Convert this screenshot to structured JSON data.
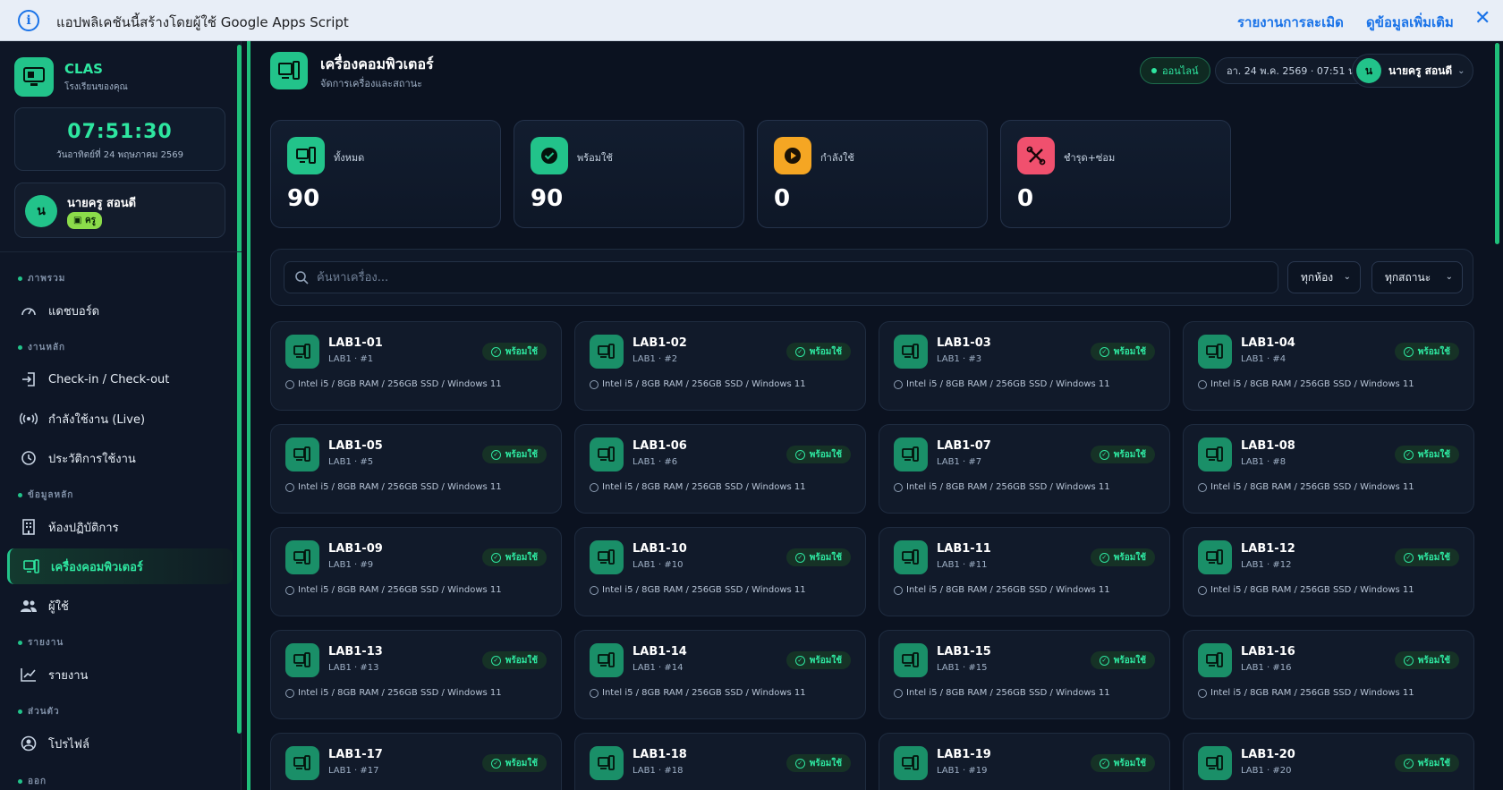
{
  "banner": {
    "text": "แอปพลิเคชันนี้สร้างโดยผู้ใช้ Google Apps Script",
    "report_link": "รายงานการละเมิด",
    "more_link": "ดูข้อมูลเพิ่มเติม",
    "close_icon": "close-icon"
  },
  "sidebar": {
    "brand_title": "CLAS",
    "brand_sub": "โรงเรียนของคุณ",
    "clock_time": "07:51:30",
    "clock_date": "วันอาทิตย์ที่ 24 พฤษภาคม 2569",
    "user_initial": "น",
    "user_name": "นายครู สอนดี",
    "user_role": "ครู",
    "sections": {
      "overview": "ภาพรวม",
      "main": "งานหลัก",
      "master": "ข้อมูลหลัก",
      "report": "รายงาน",
      "personal": "ส่วนตัว",
      "logout": "ออก"
    },
    "items": {
      "dashboard": "แดชบอร์ด",
      "checkin": "Check-in / Check-out",
      "live": "กำลังใช้งาน (Live)",
      "history": "ประวัติการใช้งาน",
      "labs": "ห้องปฏิบัติการ",
      "computers": "เครื่องคอมพิวเตอร์",
      "users": "ผู้ใช้",
      "reports": "รายงาน",
      "profile": "โปรไฟล์"
    }
  },
  "header": {
    "title": "เครื่องคอมพิวเตอร์",
    "subtitle": "จัดการเครื่องและสถานะ",
    "online": "ออนไลน์",
    "datetime": "อา. 24 พ.ค. 2569 · 07:51 น.",
    "user_initial": "น",
    "user_name": "นายครู สอนดี"
  },
  "stats": [
    {
      "label": "ทั้งหมด",
      "value": "90",
      "color": "#22c38a"
    },
    {
      "label": "พร้อมใช้",
      "value": "90",
      "color": "#22c38a"
    },
    {
      "label": "กำลังใช้",
      "value": "0",
      "color": "#f5a623"
    },
    {
      "label": "ชำรุด+ซ่อม",
      "value": "0",
      "color": "#f0506e"
    }
  ],
  "filters": {
    "search_placeholder": "ค้นหาเครื่อง...",
    "room": "ทุกห้อง",
    "status": "ทุกสถานะ"
  },
  "computers": [
    {
      "name": "LAB1-01",
      "loc": "LAB1 · #1",
      "status": "พร้อมใช้",
      "spec": "Intel i5 / 8GB RAM / 256GB SSD / Windows 11"
    },
    {
      "name": "LAB1-02",
      "loc": "LAB1 · #2",
      "status": "พร้อมใช้",
      "spec": "Intel i5 / 8GB RAM / 256GB SSD / Windows 11"
    },
    {
      "name": "LAB1-03",
      "loc": "LAB1 · #3",
      "status": "พร้อมใช้",
      "spec": "Intel i5 / 8GB RAM / 256GB SSD / Windows 11"
    },
    {
      "name": "LAB1-04",
      "loc": "LAB1 · #4",
      "status": "พร้อมใช้",
      "spec": "Intel i5 / 8GB RAM / 256GB SSD / Windows 11"
    },
    {
      "name": "LAB1-05",
      "loc": "LAB1 · #5",
      "status": "พร้อมใช้",
      "spec": "Intel i5 / 8GB RAM / 256GB SSD / Windows 11"
    },
    {
      "name": "LAB1-06",
      "loc": "LAB1 · #6",
      "status": "พร้อมใช้",
      "spec": "Intel i5 / 8GB RAM / 256GB SSD / Windows 11"
    },
    {
      "name": "LAB1-07",
      "loc": "LAB1 · #7",
      "status": "พร้อมใช้",
      "spec": "Intel i5 / 8GB RAM / 256GB SSD / Windows 11"
    },
    {
      "name": "LAB1-08",
      "loc": "LAB1 · #8",
      "status": "พร้อมใช้",
      "spec": "Intel i5 / 8GB RAM / 256GB SSD / Windows 11"
    },
    {
      "name": "LAB1-09",
      "loc": "LAB1 · #9",
      "status": "พร้อมใช้",
      "spec": "Intel i5 / 8GB RAM / 256GB SSD / Windows 11"
    },
    {
      "name": "LAB1-10",
      "loc": "LAB1 · #10",
      "status": "พร้อมใช้",
      "spec": "Intel i5 / 8GB RAM / 256GB SSD / Windows 11"
    },
    {
      "name": "LAB1-11",
      "loc": "LAB1 · #11",
      "status": "พร้อมใช้",
      "spec": "Intel i5 / 8GB RAM / 256GB SSD / Windows 11"
    },
    {
      "name": "LAB1-12",
      "loc": "LAB1 · #12",
      "status": "พร้อมใช้",
      "spec": "Intel i5 / 8GB RAM / 256GB SSD / Windows 11"
    },
    {
      "name": "LAB1-13",
      "loc": "LAB1 · #13",
      "status": "พร้อมใช้",
      "spec": "Intel i5 / 8GB RAM / 256GB SSD / Windows 11"
    },
    {
      "name": "LAB1-14",
      "loc": "LAB1 · #14",
      "status": "พร้อมใช้",
      "spec": "Intel i5 / 8GB RAM / 256GB SSD / Windows 11"
    },
    {
      "name": "LAB1-15",
      "loc": "LAB1 · #15",
      "status": "พร้อมใช้",
      "spec": "Intel i5 / 8GB RAM / 256GB SSD / Windows 11"
    },
    {
      "name": "LAB1-16",
      "loc": "LAB1 · #16",
      "status": "พร้อมใช้",
      "spec": "Intel i5 / 8GB RAM / 256GB SSD / Windows 11"
    },
    {
      "name": "LAB1-17",
      "loc": "LAB1 · #17",
      "status": "พร้อมใช้",
      "spec": ""
    },
    {
      "name": "LAB1-18",
      "loc": "LAB1 · #18",
      "status": "พร้อมใช้",
      "spec": ""
    },
    {
      "name": "LAB1-19",
      "loc": "LAB1 · #19",
      "status": "พร้อมใช้",
      "spec": ""
    },
    {
      "name": "LAB1-20",
      "loc": "LAB1 · #20",
      "status": "พร้อมใช้",
      "spec": ""
    }
  ]
}
